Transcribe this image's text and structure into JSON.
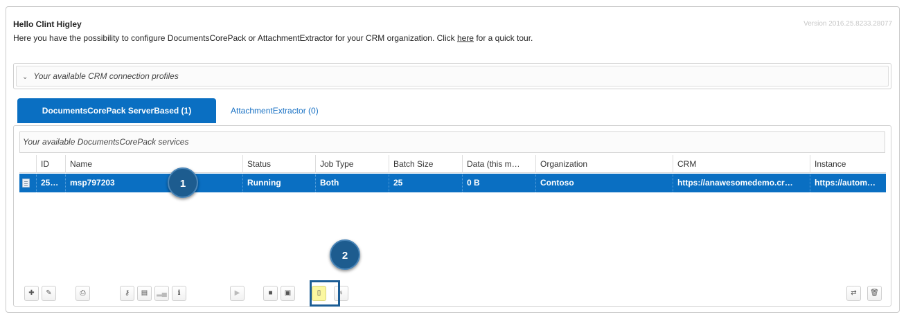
{
  "header": {
    "greeting": "Hello Clint Higley",
    "intro_prefix": "Here you have the possibility to configure DocumentsCorePack or AttachmentExtractor for your CRM organization. Click ",
    "intro_link": "here",
    "intro_suffix": " for a quick tour.",
    "version": "Version 2016.25.8233.28077"
  },
  "profiles": {
    "label": "Your available CRM connection profiles",
    "chevron_icon": "chevron-down-icon"
  },
  "tabs": [
    {
      "label": "DocumentsCorePack ServerBased (1)",
      "active": true
    },
    {
      "label": "AttachmentExtractor (0)",
      "active": false
    }
  ],
  "services": {
    "title": "Your available DocumentsCorePack services",
    "columns": [
      "ID",
      "Name",
      "Status",
      "Job Type",
      "Batch Size",
      "Data (this m…",
      "Organization",
      "CRM",
      "Instance"
    ],
    "rows": [
      {
        "icon": "document-icon",
        "id": "25…",
        "name": "msp797203",
        "status": "Running",
        "job_type": "Both",
        "batch_size": "25",
        "data": "0 B",
        "organization": "Contoso",
        "crm": "https://anawesomedemo.cr…",
        "instance": "https://autom…"
      }
    ]
  },
  "callouts": [
    "1",
    "2"
  ],
  "toolbar": {
    "buttons": [
      {
        "name": "add-button",
        "icon": "plus-icon",
        "glyph": "✚"
      },
      {
        "name": "edit-button",
        "icon": "wrench-icon",
        "glyph": "✎"
      },
      {
        "name": "print-button",
        "icon": "printer-icon",
        "glyph": "⎙"
      },
      {
        "name": "key-button",
        "icon": "key-icon",
        "glyph": "⚷"
      },
      {
        "name": "list-button",
        "icon": "list-icon",
        "glyph": "▤"
      },
      {
        "name": "stats-button",
        "icon": "bar-chart-icon",
        "glyph": "▂▄"
      },
      {
        "name": "info-button",
        "icon": "info-icon",
        "glyph": "ℹ"
      },
      {
        "name": "start-button",
        "icon": "play-icon",
        "glyph": "▶"
      },
      {
        "name": "stop-button",
        "icon": "stop-icon",
        "glyph": "■"
      },
      {
        "name": "save-button",
        "icon": "save-icon",
        "glyph": "▣"
      },
      {
        "name": "log-button",
        "icon": "file-icon",
        "glyph": "▯"
      },
      {
        "name": "tip-button",
        "icon": "lightbulb-icon",
        "glyph": "♀"
      },
      {
        "name": "swap-button",
        "icon": "swap-icon",
        "glyph": "⇄"
      },
      {
        "name": "delete-button",
        "icon": "trash-icon",
        "glyph": "🗑"
      }
    ]
  },
  "colors": {
    "accent": "#0a6fc2",
    "callout": "#1d5c8f",
    "highlight_fill": "#fbf7a0",
    "highlight_frame": "#1c5d95"
  }
}
